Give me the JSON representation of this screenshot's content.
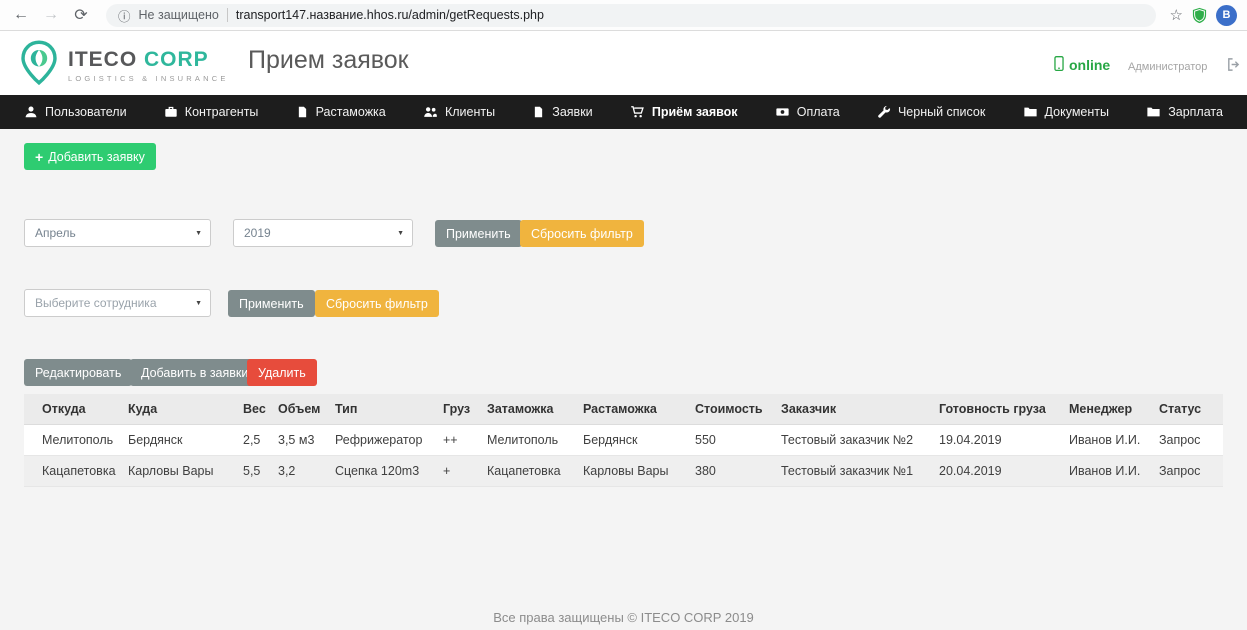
{
  "browser": {
    "security_label": "Не защищено",
    "url": "transport147.название.hhos.ru/admin/getRequests.php",
    "avatar_letter": "В",
    "icons": {
      "back": "←",
      "forward": "→",
      "reload": "⟳",
      "info": "ⓘ",
      "star": "☆"
    }
  },
  "header": {
    "brand_name_primary": "ITECO",
    "brand_name_secondary": "CORP",
    "brand_tagline": "LOGISTICS & INSURANCE",
    "page_title": "Прием заявок",
    "online_status": "online",
    "user_role": "Администратор"
  },
  "nav": {
    "items": [
      {
        "label": "Пользователи",
        "icon": "user-icon",
        "active": false
      },
      {
        "label": "Контрагенты",
        "icon": "briefcase-icon",
        "active": false
      },
      {
        "label": "Растаможка",
        "icon": "document-icon",
        "active": false
      },
      {
        "label": "Клиенты",
        "icon": "clients-icon",
        "active": false
      },
      {
        "label": "Заявки",
        "icon": "file-icon",
        "active": false
      },
      {
        "label": "Приём заявок",
        "icon": "cart-icon",
        "active": true
      },
      {
        "label": "Оплата",
        "icon": "payment-icon",
        "active": false
      },
      {
        "label": "Черный список",
        "icon": "wrench-icon",
        "active": false
      },
      {
        "label": "Документы",
        "icon": "folder-icon",
        "active": false
      },
      {
        "label": "Зарплата",
        "icon": "salary-folder-icon",
        "active": false
      }
    ]
  },
  "toolbar": {
    "plus": "+",
    "add_request_label": "Добавить заявку"
  },
  "filters": {
    "month_value": "Апрель",
    "year_value": "2019",
    "employee_placeholder": "Выберите сотрудника",
    "apply_label": "Применить",
    "reset_label": "Сбросить фильтр"
  },
  "actions": {
    "edit_label": "Редактировать",
    "add_to_requests_label": "Добавить в заявки",
    "delete_label": "Удалить"
  },
  "table": {
    "headers": [
      "Откуда",
      "Куда",
      "Вес",
      "Объем",
      "Тип",
      "Груз",
      "Затаможка",
      "Растаможка",
      "Стоимость",
      "Заказчик",
      "Готовность груза",
      "Менеджер",
      "Статус"
    ],
    "rows": [
      [
        "Мелитополь",
        "Бердянск",
        "2,5",
        "3,5 м3",
        "Рефрижератор",
        "++",
        "Мелитополь",
        "Бердянск",
        "550",
        "Тестовый заказчик №2",
        "19.04.2019",
        "Иванов И.И.",
        "Запрос"
      ],
      [
        "Кацапетовка",
        "Карловы Вары",
        "5,5",
        "3,2",
        "Сцепка 120m3",
        "+",
        "Кацапетовка",
        "Карловы Вары",
        "380",
        "Тестовый заказчик №1",
        "20.04.2019",
        "Иванов И.И.",
        "Запрос"
      ]
    ]
  },
  "footer": {
    "copyright": "Все права защищены © ITECO CORP 2019"
  }
}
